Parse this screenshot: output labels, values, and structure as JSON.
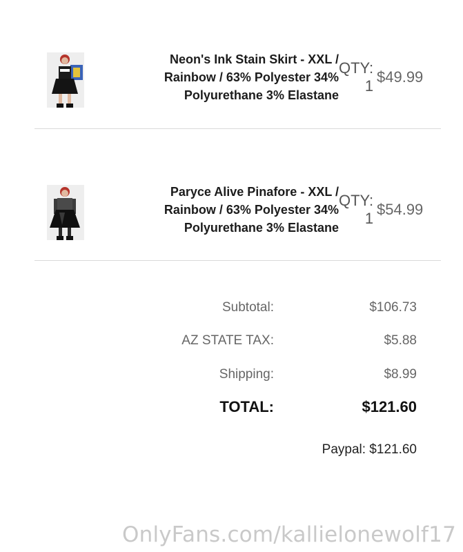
{
  "order_items": [
    {
      "name": "Neon's Ink Stain Skirt - XXL / Rainbow / 63% Polyester 34% Polyurethane 3% Elastane",
      "name_lines": [
        "Neon's Ink Stain Skirt - XXL /",
        "Rainbow / 63% Polyester 34%",
        "Polyurethane 3% Elastane"
      ],
      "qty_label": "QTY:",
      "qty": "1",
      "price": "$49.99"
    },
    {
      "name": "Paryce Alive Pinafore - XXL / Rainbow / 63% Polyester 34% Polyurethane 3% Elastane",
      "name_lines": [
        "Paryce Alive Pinafore - XXL /",
        "Rainbow / 63% Polyester 34%",
        "Polyurethane 3% Elastane"
      ],
      "qty_label": "QTY:",
      "qty": "1",
      "price": "$54.99"
    }
  ],
  "summary": {
    "subtotal_label": "Subtotal:",
    "subtotal": "$106.73",
    "tax_label": "AZ STATE TAX:",
    "tax": "$5.88",
    "shipping_label": "Shipping:",
    "shipping": "$8.99",
    "total_label": "TOTAL:",
    "total": "$121.60"
  },
  "payment": {
    "text": "Paypal: $121.60"
  },
  "watermark": "OnlyFans.com/kallielonewolf17",
  "colors": {
    "text": "#1c1c1c",
    "muted": "#666666",
    "divider": "#d9d9d9",
    "watermark": "#c9c9c9"
  }
}
